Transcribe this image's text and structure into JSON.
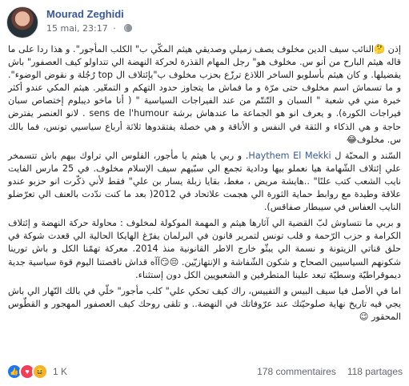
{
  "post": {
    "author": "Mourad Zeghidi",
    "date": "15 mai, 23:17",
    "dot": "·",
    "paragraphs": [
      "إذن 🤔النائب سيف الدين مخلوف يصف زميلي وصديقي هيثم المكّي ب\" الكلب المأجور\". و هذا ردا على ما قاله هيثم البارح من أنو س. مخلوف هو\" رجل المهام القذرة لحركة النهضة الي تتداولو كيف العصفور\" باش يقضيلها. و كان هيثم بأسلوبو الساخر اللاذع ترزّع بحزب مخلوف ب\"يإئتلاف ال top رُجُلة و نقوض الوضوء\". و ما تسماش اسم مخلوف حتى مرّة و ما فماش ما يتجاوز حدود التهكم و التمعّير. هيثم المكي عندو أكثر خبرة مني في شعبة \" السبان و التّنتّم من عند الفيراجات السياسية \" ( أنا ماخو ديبلوم إختصاص سبان فيراجات الكورة). و يعرف انو هو الجماعة ما عندهاش برشة sens de l'humour . لانو العنصر يفترض حاجة و هي الذكاء و الثقة في النفس و الأناقة و هي خصلة يفتقدوها ثلاثة أرباع سياسيي تونس، فما بالك س. مخلوف😂",
      "السّند و المحبّة ل Haythem El Mekki. و ربي يا هيثم يا مأجور، الفلوس الي تراوك بيهم باش تتسمخر علي إئتلاف الشّهامة هيا نعملو بيها ودادية تجمع الي سبّيهم سيف الإسلام مخلوف. في 25 مارس الفايت نايب الشعب كتب علنًا\" ..هايشة مريض ، مغط، بقايا زبلة يسار بن علي\" فقط لأني ذكّرت انو حزبو عندو علاقة وطيدة مع روابط حماية الثورة الي هجمت علاتحاد في 2012( بعد ما كنت ندّدت بالعنف الي تعرّضلو النايب العفاس في سيبطار صفاقس).",
      "و بربي ما نتساوش لبّ القضية الي آثارها هيثم و المهمة الموكولة لمخلوف : محاولة حركة النهضة و إئتلاف الكرامة و حزب الرّحمة و قلب تونس لتمرير قانون في البرلمان يفرّغ الهايكا الحالية الي قعدت شوكة في حلق قناتي الزيتونة و نسمة الي يبثّو خارج الاطر القانونية منذ 2014. معركة تهمّنا الكل و باش تورينا شكونهم السياسيين الصحاح و شكون الشّفاشة و الإنتهازيّين. 😔😏آآه قداش ناقصتنا اليوم قوة سياسية جدية ديموقراطيّة وسطيّة تبعد علينا المتطرفين و الشعبويين الكل دون إستثناء.",
      "اما في الأصل فيا سيف البيس و التفييس، راك كيف تحكي علي\" كلب مأجور\" خلّي في بالك النّهار الي باش يجي فيه تاريخ نهاية صلوحيّتك عند عرّوفاتك في النهضة.. و تلقى روحك كيف العصفور المهجور و القطّوس المحقور 😉"
    ],
    "tag_name": "Haythem El Mekki",
    "reactions": {
      "icons": [
        "like-icon",
        "love-icon",
        "haha-icon"
      ],
      "colors": {
        "like": "#1877f2",
        "love": "#f33e58",
        "haha": "#f7b125"
      },
      "count": "1 K"
    },
    "comments_count": "178 commentaires",
    "shares_count": "118 partages"
  }
}
